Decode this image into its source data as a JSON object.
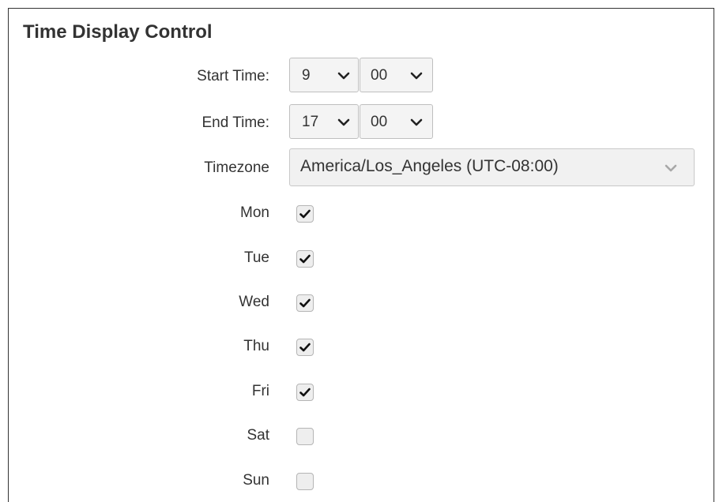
{
  "panel": {
    "title": "Time Display Control"
  },
  "start_time": {
    "label": "Start Time:",
    "hour": "9",
    "minute": "00"
  },
  "end_time": {
    "label": "End Time:",
    "hour": "17",
    "minute": "00"
  },
  "timezone": {
    "label": "Timezone",
    "value": "America/Los_Angeles (UTC-08:00)"
  },
  "days": [
    {
      "label": "Mon",
      "checked": true
    },
    {
      "label": "Tue",
      "checked": true
    },
    {
      "label": "Wed",
      "checked": true
    },
    {
      "label": "Thu",
      "checked": true
    },
    {
      "label": "Fri",
      "checked": true
    },
    {
      "label": "Sat",
      "checked": false
    },
    {
      "label": "Sun",
      "checked": false
    }
  ],
  "icons": {
    "select_chevron": "chevron-down-icon",
    "check": "checkmark-icon"
  },
  "colors": {
    "text": "#333333",
    "select_bg": "#f4f4f4",
    "select_border": "#bfbfbf",
    "checkbox_bg": "#eeeeee",
    "chevron_active": "#222222",
    "chevron_muted": "#a8a8a8"
  }
}
